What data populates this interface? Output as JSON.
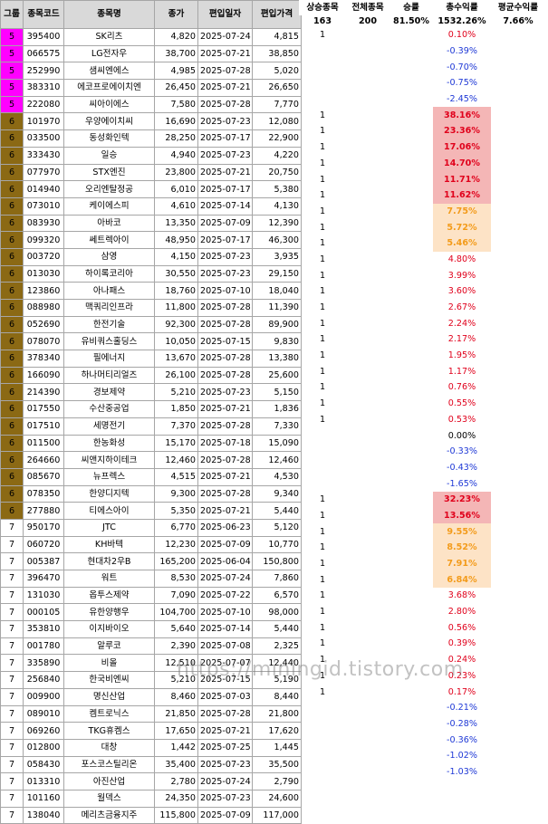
{
  "headers": {
    "group": "그룹",
    "code": "종목코드",
    "name": "종목명",
    "price": "종가",
    "date": "편입일자",
    "entry": "편입가격"
  },
  "side_headers": {
    "up": "상승종목",
    "total": "전체종목",
    "winrate": "승률",
    "sum": "총수익률",
    "avg": "평균수익률"
  },
  "summary": {
    "up": "163",
    "total": "200",
    "winrate": "81.50%",
    "sum": "1532.26%",
    "avg": "7.66%"
  },
  "rows": [
    {
      "g": "5",
      "code": "395400",
      "name": "SK리츠",
      "price": "4,820",
      "date": "2025-07-24",
      "entry": "4,815",
      "up": "1",
      "ret": "0.10%",
      "s": "pos"
    },
    {
      "g": "5",
      "code": "066575",
      "name": "LG전자우",
      "price": "38,700",
      "date": "2025-07-21",
      "entry": "38,850",
      "up": "",
      "ret": "-0.39%",
      "s": "neg"
    },
    {
      "g": "5",
      "code": "252990",
      "name": "샘씨엔에스",
      "price": "4,985",
      "date": "2025-07-28",
      "entry": "5,020",
      "up": "",
      "ret": "-0.70%",
      "s": "neg"
    },
    {
      "g": "5",
      "code": "383310",
      "name": "에코프로에이치엔",
      "price": "26,450",
      "date": "2025-07-21",
      "entry": "26,650",
      "up": "",
      "ret": "-0.75%",
      "s": "neg"
    },
    {
      "g": "5",
      "code": "222080",
      "name": "씨아이에스",
      "price": "7,580",
      "date": "2025-07-28",
      "entry": "7,770",
      "up": "",
      "ret": "-2.45%",
      "s": "neg"
    },
    {
      "g": "6",
      "code": "101970",
      "name": "우양에이치씨",
      "price": "16,690",
      "date": "2025-07-23",
      "entry": "12,080",
      "up": "1",
      "ret": "38.16%",
      "s": "hi1"
    },
    {
      "g": "6",
      "code": "033500",
      "name": "동성화인텍",
      "price": "28,250",
      "date": "2025-07-17",
      "entry": "22,900",
      "up": "1",
      "ret": "23.36%",
      "s": "hi1"
    },
    {
      "g": "6",
      "code": "333430",
      "name": "일승",
      "price": "4,940",
      "date": "2025-07-23",
      "entry": "4,220",
      "up": "1",
      "ret": "17.06%",
      "s": "hi1"
    },
    {
      "g": "6",
      "code": "077970",
      "name": "STX엔진",
      "price": "23,800",
      "date": "2025-07-21",
      "entry": "20,750",
      "up": "1",
      "ret": "14.70%",
      "s": "hi1"
    },
    {
      "g": "6",
      "code": "014940",
      "name": "오리엔탈정공",
      "price": "6,010",
      "date": "2025-07-17",
      "entry": "5,380",
      "up": "1",
      "ret": "11.71%",
      "s": "hi1"
    },
    {
      "g": "6",
      "code": "073010",
      "name": "케이에스피",
      "price": "4,610",
      "date": "2025-07-14",
      "entry": "4,130",
      "up": "1",
      "ret": "11.62%",
      "s": "hi1"
    },
    {
      "g": "6",
      "code": "083930",
      "name": "아바코",
      "price": "13,350",
      "date": "2025-07-09",
      "entry": "12,390",
      "up": "1",
      "ret": "7.75%",
      "s": "hi2"
    },
    {
      "g": "6",
      "code": "099320",
      "name": "쎄트렉아이",
      "price": "48,950",
      "date": "2025-07-17",
      "entry": "46,300",
      "up": "1",
      "ret": "5.72%",
      "s": "hi2"
    },
    {
      "g": "6",
      "code": "003720",
      "name": "삼영",
      "price": "4,150",
      "date": "2025-07-23",
      "entry": "3,935",
      "up": "1",
      "ret": "5.46%",
      "s": "hi2"
    },
    {
      "g": "6",
      "code": "013030",
      "name": "하이록코리아",
      "price": "30,550",
      "date": "2025-07-23",
      "entry": "29,150",
      "up": "1",
      "ret": "4.80%",
      "s": "pos"
    },
    {
      "g": "6",
      "code": "123860",
      "name": "아나패스",
      "price": "18,760",
      "date": "2025-07-10",
      "entry": "18,040",
      "up": "1",
      "ret": "3.99%",
      "s": "pos"
    },
    {
      "g": "6",
      "code": "088980",
      "name": "맥쿼리인프라",
      "price": "11,800",
      "date": "2025-07-28",
      "entry": "11,390",
      "up": "1",
      "ret": "3.60%",
      "s": "pos"
    },
    {
      "g": "6",
      "code": "052690",
      "name": "한전기술",
      "price": "92,300",
      "date": "2025-07-28",
      "entry": "89,900",
      "up": "1",
      "ret": "2.67%",
      "s": "pos"
    },
    {
      "g": "6",
      "code": "078070",
      "name": "유비쿼스홀딩스",
      "price": "10,050",
      "date": "2025-07-15",
      "entry": "9,830",
      "up": "1",
      "ret": "2.24%",
      "s": "pos"
    },
    {
      "g": "6",
      "code": "378340",
      "name": "필에너지",
      "price": "13,670",
      "date": "2025-07-28",
      "entry": "13,380",
      "up": "1",
      "ret": "2.17%",
      "s": "pos"
    },
    {
      "g": "6",
      "code": "166090",
      "name": "하나머티리얼즈",
      "price": "26,100",
      "date": "2025-07-28",
      "entry": "25,600",
      "up": "1",
      "ret": "1.95%",
      "s": "pos"
    },
    {
      "g": "6",
      "code": "214390",
      "name": "경보제약",
      "price": "5,210",
      "date": "2025-07-23",
      "entry": "5,150",
      "up": "1",
      "ret": "1.17%",
      "s": "pos"
    },
    {
      "g": "6",
      "code": "017550",
      "name": "수산중공업",
      "price": "1,850",
      "date": "2025-07-21",
      "entry": "1,836",
      "up": "1",
      "ret": "0.76%",
      "s": "pos"
    },
    {
      "g": "6",
      "code": "017510",
      "name": "세명전기",
      "price": "7,370",
      "date": "2025-07-28",
      "entry": "7,330",
      "up": "1",
      "ret": "0.55%",
      "s": "pos"
    },
    {
      "g": "6",
      "code": "011500",
      "name": "한농화성",
      "price": "15,170",
      "date": "2025-07-18",
      "entry": "15,090",
      "up": "1",
      "ret": "0.53%",
      "s": "pos"
    },
    {
      "g": "6",
      "code": "264660",
      "name": "씨앤지하이테크",
      "price": "12,460",
      "date": "2025-07-28",
      "entry": "12,460",
      "up": "",
      "ret": "0.00%",
      "s": "zero"
    },
    {
      "g": "6",
      "code": "085670",
      "name": "뉴프렉스",
      "price": "4,515",
      "date": "2025-07-21",
      "entry": "4,530",
      "up": "",
      "ret": "-0.33%",
      "s": "neg"
    },
    {
      "g": "6",
      "code": "078350",
      "name": "한양디지텍",
      "price": "9,300",
      "date": "2025-07-28",
      "entry": "9,340",
      "up": "",
      "ret": "-0.43%",
      "s": "neg"
    },
    {
      "g": "6",
      "code": "277880",
      "name": "티에스아이",
      "price": "5,350",
      "date": "2025-07-21",
      "entry": "5,440",
      "up": "",
      "ret": "-1.65%",
      "s": "neg"
    },
    {
      "g": "7",
      "code": "950170",
      "name": "JTC",
      "price": "6,770",
      "date": "2025-06-23",
      "entry": "5,120",
      "up": "1",
      "ret": "32.23%",
      "s": "hi1"
    },
    {
      "g": "7",
      "code": "060720",
      "name": "KH바텍",
      "price": "12,230",
      "date": "2025-07-09",
      "entry": "10,770",
      "up": "1",
      "ret": "13.56%",
      "s": "hi1"
    },
    {
      "g": "7",
      "code": "005387",
      "name": "현대차2우B",
      "price": "165,200",
      "date": "2025-06-04",
      "entry": "150,800",
      "up": "1",
      "ret": "9.55%",
      "s": "hi2"
    },
    {
      "g": "7",
      "code": "396470",
      "name": "워트",
      "price": "8,530",
      "date": "2025-07-24",
      "entry": "7,860",
      "up": "1",
      "ret": "8.52%",
      "s": "hi2"
    },
    {
      "g": "7",
      "code": "131030",
      "name": "옵투스제약",
      "price": "7,090",
      "date": "2025-07-22",
      "entry": "6,570",
      "up": "1",
      "ret": "7.91%",
      "s": "hi2"
    },
    {
      "g": "7",
      "code": "000105",
      "name": "유한양행우",
      "price": "104,700",
      "date": "2025-07-10",
      "entry": "98,000",
      "up": "1",
      "ret": "6.84%",
      "s": "hi2"
    },
    {
      "g": "7",
      "code": "353810",
      "name": "이지바이오",
      "price": "5,640",
      "date": "2025-07-14",
      "entry": "5,440",
      "up": "1",
      "ret": "3.68%",
      "s": "pos"
    },
    {
      "g": "7",
      "code": "001780",
      "name": "알루코",
      "price": "2,390",
      "date": "2025-07-08",
      "entry": "2,325",
      "up": "1",
      "ret": "2.80%",
      "s": "pos"
    },
    {
      "g": "7",
      "code": "335890",
      "name": "비올",
      "price": "12,510",
      "date": "2025-07-07",
      "entry": "12,440",
      "up": "1",
      "ret": "0.56%",
      "s": "pos"
    },
    {
      "g": "7",
      "code": "256840",
      "name": "한국비엔씨",
      "price": "5,210",
      "date": "2025-07-15",
      "entry": "5,190",
      "up": "1",
      "ret": "0.39%",
      "s": "pos"
    },
    {
      "g": "7",
      "code": "009900",
      "name": "명신산업",
      "price": "8,460",
      "date": "2025-07-03",
      "entry": "8,440",
      "up": "1",
      "ret": "0.24%",
      "s": "pos"
    },
    {
      "g": "7",
      "code": "089010",
      "name": "켐트로닉스",
      "price": "21,850",
      "date": "2025-07-28",
      "entry": "21,800",
      "up": "1",
      "ret": "0.23%",
      "s": "pos"
    },
    {
      "g": "7",
      "code": "069260",
      "name": "TKG휴켐스",
      "price": "17,650",
      "date": "2025-07-21",
      "entry": "17,620",
      "up": "1",
      "ret": "0.17%",
      "s": "pos"
    },
    {
      "g": "7",
      "code": "012800",
      "name": "대창",
      "price": "1,442",
      "date": "2025-07-25",
      "entry": "1,445",
      "up": "",
      "ret": "-0.21%",
      "s": "neg"
    },
    {
      "g": "7",
      "code": "058430",
      "name": "포스코스틸리온",
      "price": "35,400",
      "date": "2025-07-23",
      "entry": "35,500",
      "up": "",
      "ret": "-0.28%",
      "s": "neg"
    },
    {
      "g": "7",
      "code": "013310",
      "name": "아진산업",
      "price": "2,780",
      "date": "2025-07-24",
      "entry": "2,790",
      "up": "",
      "ret": "-0.36%",
      "s": "neg"
    },
    {
      "g": "7",
      "code": "101160",
      "name": "월덱스",
      "price": "24,350",
      "date": "2025-07-23",
      "entry": "24,600",
      "up": "",
      "ret": "-1.02%",
      "s": "neg"
    },
    {
      "g": "7",
      "code": "138040",
      "name": "메리츠금융지주",
      "price": "115,800",
      "date": "2025-07-09",
      "entry": "117,000",
      "up": "",
      "ret": "-1.03%",
      "s": "neg"
    }
  ],
  "watermark": "https://miningid.tistory.com"
}
